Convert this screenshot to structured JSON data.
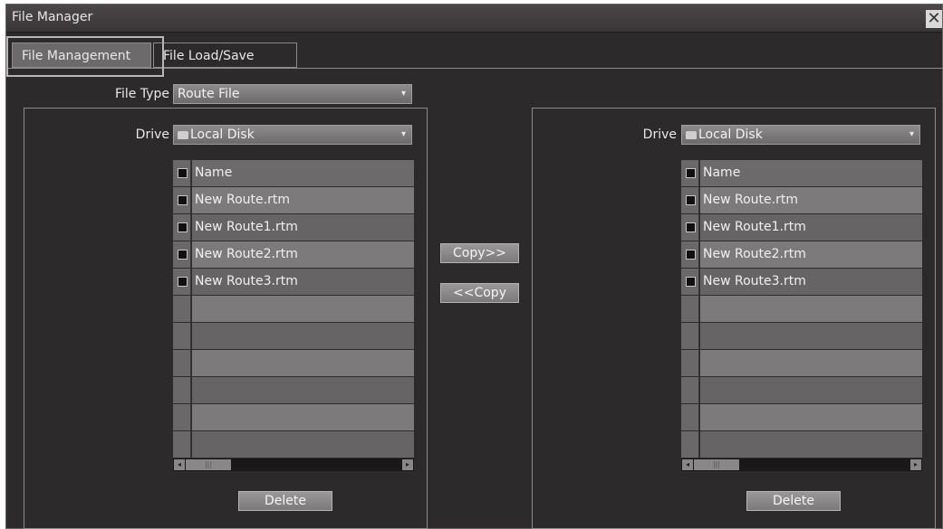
{
  "window": {
    "title": "File Manager",
    "close_glyph": "✕"
  },
  "tabs": [
    {
      "label": "File Management",
      "active": true
    },
    {
      "label": "File Load/Save",
      "active": false
    }
  ],
  "file_type": {
    "label": "File Type",
    "value": "Route File",
    "arrow_icon": "chevron-down-icon"
  },
  "copy_right_label": "Copy>>",
  "copy_left_label": "<<Copy",
  "left_panel": {
    "drive_label": "Drive",
    "drive_value": "Local Disk",
    "header": "Name",
    "files": [
      "New Route.rtm",
      "New Route1.rtm",
      "New Route2.rtm",
      "New Route3.rtm"
    ],
    "delete_label": "Delete"
  },
  "right_panel": {
    "drive_label": "Drive",
    "drive_value": "Local Disk",
    "header": "Name",
    "files": [
      "New Route.rtm",
      "New Route1.rtm",
      "New Route2.rtm",
      "New Route3.rtm"
    ],
    "delete_label": "Delete"
  },
  "colors": {
    "background": "#2d2a2b",
    "row_light": "#7d7a7c",
    "row_dark": "#676466",
    "border": "#8d8b8c"
  }
}
